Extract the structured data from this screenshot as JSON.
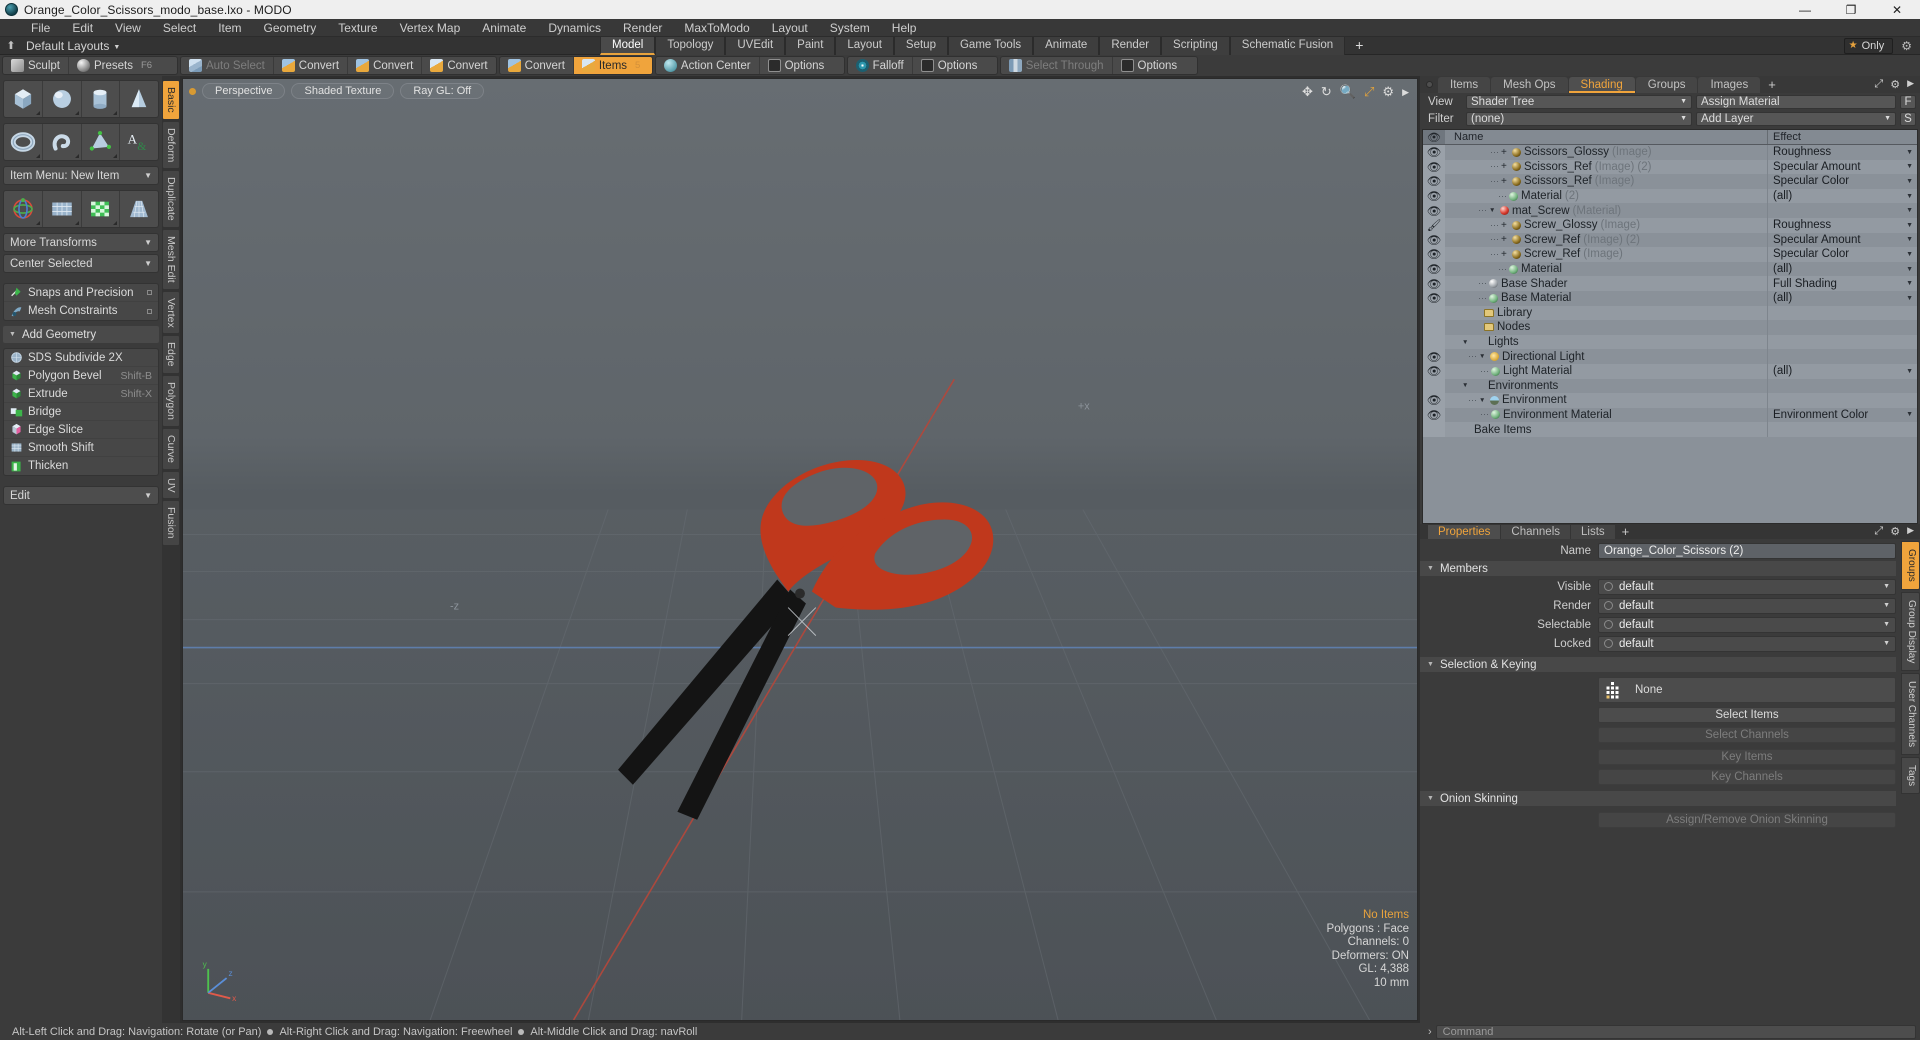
{
  "window": {
    "title": "Orange_Color_Scissors_modo_base.lxo - MODO",
    "app_icon": "modo-logo-icon",
    "minimize": "—",
    "maximize": "❐",
    "close": "✕"
  },
  "menubar": {
    "items": [
      "File",
      "Edit",
      "View",
      "Select",
      "Item",
      "Geometry",
      "Texture",
      "Vertex Map",
      "Animate",
      "Dynamics",
      "Render",
      "MaxToModo",
      "Layout",
      "System",
      "Help"
    ]
  },
  "layoutbar": {
    "pin_icon": "pin-icon",
    "layouts_label": "Default Layouts",
    "tabs": [
      "Model",
      "Topology",
      "UVEdit",
      "Paint",
      "Layout",
      "Setup",
      "Game Tools",
      "Animate",
      "Render",
      "Scripting",
      "Schematic Fusion"
    ],
    "active_tab": "Model",
    "add_tab": "+",
    "only_label": "Only",
    "gear_icon": "gear-icon"
  },
  "toolbar": {
    "groups": [
      {
        "buttons": [
          {
            "label": "Sculpt",
            "icon": "sculpt-icon",
            "hotkey": "",
            "state": "normal"
          },
          {
            "label": "Presets",
            "icon": "presets-ball-icon",
            "hotkey": "F6",
            "state": "normal"
          }
        ]
      },
      {
        "buttons": [
          {
            "label": "Auto Select",
            "icon": "cube-gray-icon",
            "hotkey": "",
            "state": "dim"
          },
          {
            "label": "Convert",
            "icon": "cube-convert-icon",
            "hotkey": "",
            "state": "normal"
          },
          {
            "label": "Convert",
            "icon": "cube-convert-icon",
            "hotkey": "",
            "state": "normal"
          },
          {
            "label": "Convert",
            "icon": "cube-convert-icon",
            "hotkey": "",
            "state": "normal"
          }
        ]
      },
      {
        "buttons": [
          {
            "label": "Convert",
            "icon": "cube-convert-icon",
            "hotkey": "",
            "state": "normal"
          },
          {
            "label": "Items",
            "icon": "cube-items-icon",
            "hotkey": "5",
            "state": "active"
          }
        ]
      },
      {
        "buttons": [
          {
            "label": "Action Center",
            "icon": "action-center-icon",
            "hotkey": "",
            "state": "normal"
          },
          {
            "label": "Options",
            "icon": "options-icon",
            "hotkey": "",
            "state": "normal"
          }
        ]
      },
      {
        "buttons": [
          {
            "label": "Falloff",
            "icon": "falloff-icon",
            "hotkey": "",
            "state": "normal"
          },
          {
            "label": "Options",
            "icon": "options-icon",
            "hotkey": "",
            "state": "normal"
          }
        ]
      },
      {
        "buttons": [
          {
            "label": "Select Through",
            "icon": "select-through-icon",
            "hotkey": "",
            "state": "dim"
          },
          {
            "label": "Options",
            "icon": "options-icon",
            "hotkey": "",
            "state": "normal"
          }
        ]
      }
    ]
  },
  "left_panel": {
    "primitive_icons_row1": [
      "cube-primitive-icon",
      "sphere-primitive-icon",
      "cylinder-primitive-icon",
      "cone-primitive-icon"
    ],
    "primitive_icons_row2": [
      "torus-primitive-icon",
      "spiral-primitive-icon",
      "polygon-primitive-icon",
      "text-primitive-icon"
    ],
    "item_menu": "Item Menu: New Item",
    "transform_icons": [
      "transform-gizmo-icon",
      "lattice-icon",
      "flex-icon",
      "taper-icon"
    ],
    "more_transforms": "More Transforms",
    "center_selected": "Center Selected",
    "snaps": {
      "label": "Snaps and Precision",
      "icon": "snap-icon"
    },
    "mesh_constraints": {
      "label": "Mesh Constraints",
      "icon": "constraint-icon"
    },
    "add_geometry_header": "Add Geometry",
    "geometry_items": [
      {
        "label": "SDS Subdivide 2X",
        "hotkey": "",
        "icon": "sds-icon"
      },
      {
        "label": "Polygon Bevel",
        "hotkey": "Shift-B",
        "icon": "bevel-icon"
      },
      {
        "label": "Extrude",
        "hotkey": "Shift-X",
        "icon": "extrude-icon"
      },
      {
        "label": "Bridge",
        "hotkey": "",
        "icon": "bridge-icon"
      },
      {
        "label": "Edge Slice",
        "hotkey": "",
        "icon": "edge-slice-icon"
      },
      {
        "label": "Smooth Shift",
        "hotkey": "",
        "icon": "smooth-shift-icon"
      },
      {
        "label": "Thicken",
        "hotkey": "",
        "icon": "thicken-icon"
      }
    ],
    "edit_dropdown": "Edit",
    "vertical_tabs": [
      {
        "label": "Basic",
        "active": true
      },
      {
        "label": "Deform",
        "active": false
      },
      {
        "label": "Duplicate",
        "active": false
      },
      {
        "label": "Mesh Edit",
        "active": false
      },
      {
        "label": "Vertex",
        "active": false
      },
      {
        "label": "Edge",
        "active": false
      },
      {
        "label": "Polygon",
        "active": false
      },
      {
        "label": "Curve",
        "active": false
      },
      {
        "label": "UV",
        "active": false
      },
      {
        "label": "Fusion",
        "active": false
      }
    ]
  },
  "viewport": {
    "mode_buttons": [
      "Perspective",
      "Shaded Texture",
      "Ray GL: Off"
    ],
    "tool_icons": [
      "move-icon",
      "rotate-icon",
      "zoom-icon",
      "fit-icon",
      "gear-icon",
      "chevron-right-icon"
    ],
    "stats": {
      "selection": "No Items",
      "polygons": "Polygons : Face",
      "channels": "Channels: 0",
      "deformers": "Deformers: ON",
      "gl": "GL: 4,388",
      "grid": "10 mm"
    },
    "gizmo_axes": [
      "x",
      "y",
      "z"
    ]
  },
  "right_panel": {
    "tabs": [
      {
        "label": "Items",
        "active": false
      },
      {
        "label": "Mesh Ops",
        "active": false
      },
      {
        "label": "Shading",
        "active": true
      },
      {
        "label": "Groups",
        "active": false
      },
      {
        "label": "Images",
        "active": false
      },
      {
        "label": "+",
        "active": false
      }
    ],
    "panel_icons": [
      "expand-icon",
      "gear-icon",
      "chevron-right-icon"
    ],
    "view_label": "View",
    "view_value": "Shader Tree",
    "assign_material": "Assign Material",
    "filter_label": "Filter",
    "filter_value": "(none)",
    "add_layer": "Add Layer",
    "side_buttons": [
      "F",
      "S"
    ],
    "tree_headers": {
      "eye": "eye-icon",
      "name": "Name",
      "effect": "Effect"
    },
    "tree_rows": [
      {
        "name": "Scissors_Glossy",
        "sub": "(Image)",
        "sub2": "",
        "effect": "Roughness",
        "indent": 4,
        "icon": "image-sphere-icon",
        "expander": "+",
        "eye": "eye-icon"
      },
      {
        "name": "Scissors_Ref",
        "sub": "(Image)",
        "sub2": "(2)",
        "effect": "Specular Amount",
        "indent": 4,
        "icon": "image-sphere-icon",
        "expander": "+",
        "eye": "eye-icon"
      },
      {
        "name": "Scissors_Ref",
        "sub": "(Image)",
        "sub2": "",
        "effect": "Specular Color",
        "indent": 4,
        "icon": "image-sphere-icon",
        "expander": "+",
        "eye": "eye-icon"
      },
      {
        "name": "Material",
        "sub": "",
        "sub2": "(2)",
        "effect": "(all)",
        "indent": 4,
        "icon": "material-sphere-icon",
        "expander": "",
        "eye": "eye-icon"
      },
      {
        "name": "mat_Screw",
        "sub": "(Material)",
        "sub2": "",
        "effect": "",
        "indent": 3,
        "icon": "material-red-icon",
        "expander": "▼",
        "eye": "eye-icon"
      },
      {
        "name": "Screw_Glossy",
        "sub": "(Image)",
        "sub2": "",
        "effect": "Roughness",
        "indent": 4,
        "icon": "image-sphere-icon",
        "expander": "+",
        "eye": "brush-icon"
      },
      {
        "name": "Screw_Ref",
        "sub": "(Image)",
        "sub2": "(2)",
        "effect": "Specular Amount",
        "indent": 4,
        "icon": "image-sphere-icon",
        "expander": "+",
        "eye": "eye-icon"
      },
      {
        "name": "Screw_Ref",
        "sub": "(Image)",
        "sub2": "",
        "effect": "Specular Color",
        "indent": 4,
        "icon": "image-sphere-icon",
        "expander": "+",
        "eye": "eye-icon"
      },
      {
        "name": "Material",
        "sub": "",
        "sub2": "",
        "effect": "(all)",
        "indent": 4,
        "icon": "material-sphere-icon",
        "expander": "",
        "eye": "eye-icon"
      },
      {
        "name": "Base Shader",
        "sub": "",
        "sub2": "",
        "effect": "Full Shading",
        "indent": 3,
        "icon": "shader-sphere-icon",
        "expander": "",
        "eye": "eye-icon"
      },
      {
        "name": "Base Material",
        "sub": "",
        "sub2": "",
        "effect": "(all)",
        "indent": 3,
        "icon": "material-sphere-icon",
        "expander": "",
        "eye": "eye-icon"
      },
      {
        "name": "Library",
        "sub": "",
        "sub2": "",
        "effect": "",
        "indent": 3,
        "icon": "folder-icon",
        "expander": "",
        "eye": ""
      },
      {
        "name": "Nodes",
        "sub": "",
        "sub2": "",
        "effect": "",
        "indent": 3,
        "icon": "folder-icon",
        "expander": "",
        "eye": ""
      },
      {
        "name": "Lights",
        "sub": "",
        "sub2": "",
        "effect": "",
        "indent": 1,
        "icon": "",
        "expander": "▼",
        "eye": ""
      },
      {
        "name": "Directional Light",
        "sub": "",
        "sub2": "",
        "effect": "",
        "indent": 2,
        "icon": "light-icon",
        "expander": "▼",
        "eye": "eye-icon"
      },
      {
        "name": "Light Material",
        "sub": "",
        "sub2": "",
        "effect": "(all)",
        "indent": 3,
        "icon": "material-sphere-icon",
        "expander": "",
        "eye": "eye-icon"
      },
      {
        "name": "Environments",
        "sub": "",
        "sub2": "",
        "effect": "",
        "indent": 1,
        "icon": "",
        "expander": "▼",
        "eye": ""
      },
      {
        "name": "Environment",
        "sub": "",
        "sub2": "",
        "effect": "",
        "indent": 2,
        "icon": "environment-icon",
        "expander": "▼",
        "eye": "eye-icon"
      },
      {
        "name": "Environment Material",
        "sub": "",
        "sub2": "",
        "effect": "Environment Color",
        "indent": 3,
        "icon": "material-sphere-icon",
        "expander": "",
        "eye": "eye-icon"
      },
      {
        "name": "Bake Items",
        "sub": "",
        "sub2": "",
        "effect": "",
        "indent": 1,
        "icon": "",
        "expander": "",
        "eye": ""
      }
    ]
  },
  "properties": {
    "tabs": [
      {
        "label": "Properties",
        "active": true
      },
      {
        "label": "Channels",
        "active": false
      },
      {
        "label": "Lists",
        "active": false
      },
      {
        "label": "+",
        "active": false
      }
    ],
    "panel_icons": [
      "expand-icon",
      "gear-icon",
      "chevron-right-icon"
    ],
    "name_label": "Name",
    "name_value": "Orange_Color_Scissors (2)",
    "members_header": "Members",
    "member_rows": [
      {
        "label": "Visible",
        "value": "default"
      },
      {
        "label": "Render",
        "value": "default"
      },
      {
        "label": "Selectable",
        "value": "default"
      },
      {
        "label": "Locked",
        "value": "default"
      }
    ],
    "selection_header": "Selection & Keying",
    "selection_set_value": "None",
    "selection_buttons": [
      {
        "label": "Select Items",
        "enabled": true
      },
      {
        "label": "Select Channels",
        "enabled": false
      },
      {
        "label": "Key Items",
        "enabled": false
      },
      {
        "label": "Key Channels",
        "enabled": false
      }
    ],
    "onion_header": "Onion Skinning",
    "onion_button": {
      "label": "Assign/Remove Onion Skinning",
      "enabled": false
    },
    "vertical_tabs": [
      {
        "label": "Groups",
        "active": true
      },
      {
        "label": "Group Display",
        "active": false
      },
      {
        "label": "User Channels",
        "active": false
      },
      {
        "label": "Tags",
        "active": false
      }
    ]
  },
  "statusbar": {
    "hint_1": "Alt-Left Click and Drag: Navigation: Rotate (or Pan)",
    "hint_2": "Alt-Right Click and Drag: Navigation: Freewheel",
    "hint_3": "Alt-Middle Click and Drag: navRoll",
    "command_placeholder": "Command",
    "command_caret": "›"
  },
  "colors": {
    "accent": "#f0a43c",
    "panel": "#3b3b3b",
    "tree_bg": "#8a9199",
    "viewport": "#5d6368",
    "scissors_orange": "#c0381c",
    "scissors_black": "#121212"
  }
}
